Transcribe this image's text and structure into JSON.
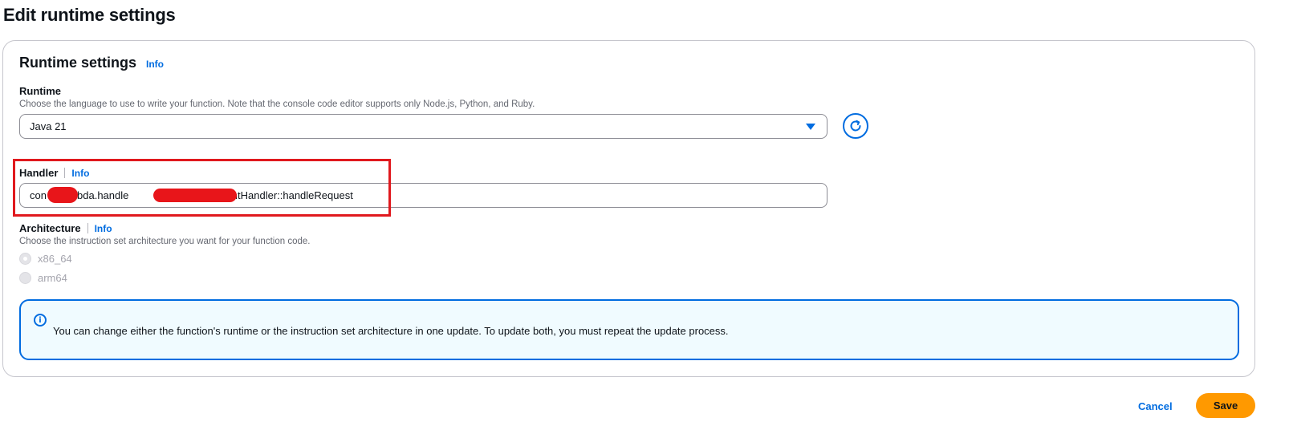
{
  "page": {
    "title": "Edit runtime settings"
  },
  "panel": {
    "title": "Runtime settings",
    "info": "Info"
  },
  "runtime": {
    "label": "Runtime",
    "description": "Choose the language to use to write your function. Note that the console code editor supports only Node.js, Python, and Ruby.",
    "selected": "Java 21"
  },
  "handler": {
    "label": "Handler",
    "info": "Info",
    "value_part1": "con",
    "value_part2": "ambda.handle",
    "value_part3": "EventHandler::handleRequest"
  },
  "architecture": {
    "label": "Architecture",
    "info": "Info",
    "description": "Choose the instruction set architecture you want for your function code.",
    "options": [
      {
        "label": "x86_64",
        "selected": true,
        "disabled": true
      },
      {
        "label": "arm64",
        "selected": false,
        "disabled": true
      }
    ]
  },
  "alert": {
    "icon": "info-icon",
    "text": "You can change either the function's runtime or the instruction set architecture in one update. To update both, you must repeat the update process."
  },
  "actions": {
    "cancel": "Cancel",
    "save": "Save"
  },
  "colors": {
    "link": "#006ce0",
    "primary_button": "#ff9900",
    "highlight": "#e0191e",
    "alert_bg": "#f0fbff"
  }
}
